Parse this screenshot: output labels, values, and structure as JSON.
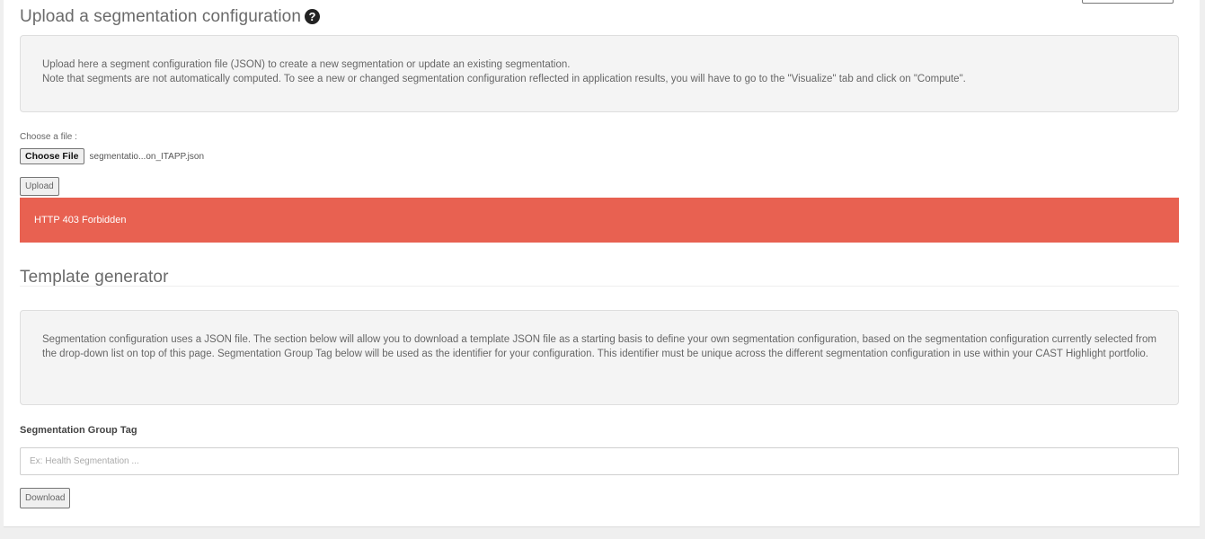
{
  "upload_section": {
    "title": "Upload a segmentation configuration",
    "help_icon": "question-circle-icon",
    "info_line1": "Upload here a segment configuration file (JSON) to create a new segmentation or update an existing segmentation.",
    "info_line2": "Note that segments are not automatically computed. To see a new or changed segmentation configuration reflected in application results, you will have to go to the \"Visualize\" tab and click on \"Compute\".",
    "choose_label": "Choose a file :",
    "choose_button": "Choose File",
    "file_name": "segmentatio...on_ITAPP.json",
    "upload_button": "Upload",
    "error_message": "HTTP 403 Forbidden",
    "error_color": "#e86151"
  },
  "template_section": {
    "title": "Template generator",
    "info": "Segmentation configuration uses a JSON file. The section below will allow you to download a template JSON file as a starting basis to define your own segmentation configuration, based on the segmentation configuration currently selected from the drop-down list on top of this page. Segmentation Group Tag below will be used as the identifier for your configuration. This identifier must be unique across the different segmentation configuration in use within your CAST Highlight portfolio.",
    "tag_label": "Segmentation Group Tag",
    "tag_value": "",
    "tag_placeholder": "Ex: Health Segmentation ...",
    "download_button": "Download"
  }
}
